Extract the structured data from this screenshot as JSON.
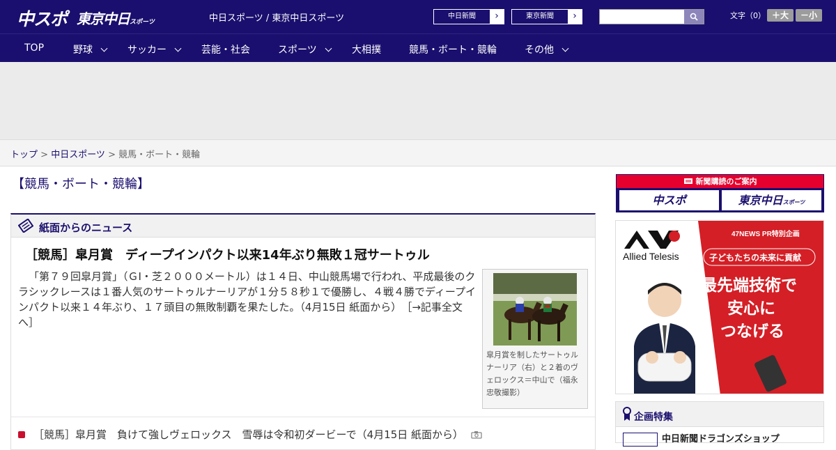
{
  "header": {
    "logo_main": "中スポ",
    "logo_tokyo": "東京中日",
    "logo_tokyo_small": "スポーツ",
    "site_names": "中日スポーツ / 東京中日スポーツ",
    "link_chunichi": "中日新聞",
    "link_tokyo": "東京新聞",
    "arrow": "›",
    "search_placeholder": "",
    "font_size_label": "文字（0）",
    "font_up": "＋大",
    "font_down": "－小"
  },
  "nav": {
    "items": [
      {
        "label": "TOP"
      },
      {
        "label": "野球"
      },
      {
        "label": "サッカー"
      },
      {
        "label": "芸能・社会"
      },
      {
        "label": "スポーツ"
      },
      {
        "label": "大相撲"
      },
      {
        "label": "競馬・ボート・競輪"
      },
      {
        "label": "その他"
      }
    ]
  },
  "breadcrumb": {
    "home": "トップ",
    "site": "中日スポーツ",
    "current": "競馬・ボート・競輪",
    "sep": " > "
  },
  "page_title": "【競馬・ボート・競輪】",
  "news": {
    "section_title": "紙面からのニュース",
    "headline": "［競馬］皐月賞　ディープインパクト以来14年ぶり無敗１冠サートゥル",
    "lede": "「第７９回皐月賞」（ＧⅠ・芝２０００メートル）は１４日、中山競馬場で行われ、平成最後のクラシックレースは１番人気のサートゥルナーリアが１分５８秒１で優勝し、４戦４勝でディープインパクト以来１４年ぶり、１７頭目の無敗制覇を果たした。（4月15日 紙面から）",
    "more_link": "［→記事全文へ］",
    "photo_caption": "皐月賞を制したサートゥルナーリア（右）と２着のヴェロックス＝中山で（福永忠敬撮影）",
    "list": [
      {
        "text": "［競馬］皐月賞　負けて強しヴェロックス　雪辱は令和初ダービーで（4月15日 紙面から）"
      }
    ]
  },
  "sidebar": {
    "subscribe_title": "新聞購読のご案内",
    "sub_chuspo": "中スポ",
    "sub_tokyo": "東京中日",
    "sub_tokyo_small": "スポーツ",
    "ad": {
      "brand": "Allied Telesis",
      "tag": "47NEWS PR特別企画",
      "sub": "子どもたちの未来に貢献",
      "main1": "最先端技術で",
      "main2": "安心に",
      "main3": "つなげる"
    },
    "kikaku_title": "企画特集",
    "kikaku_item": "中日新聞ドラゴンズショップ"
  }
}
